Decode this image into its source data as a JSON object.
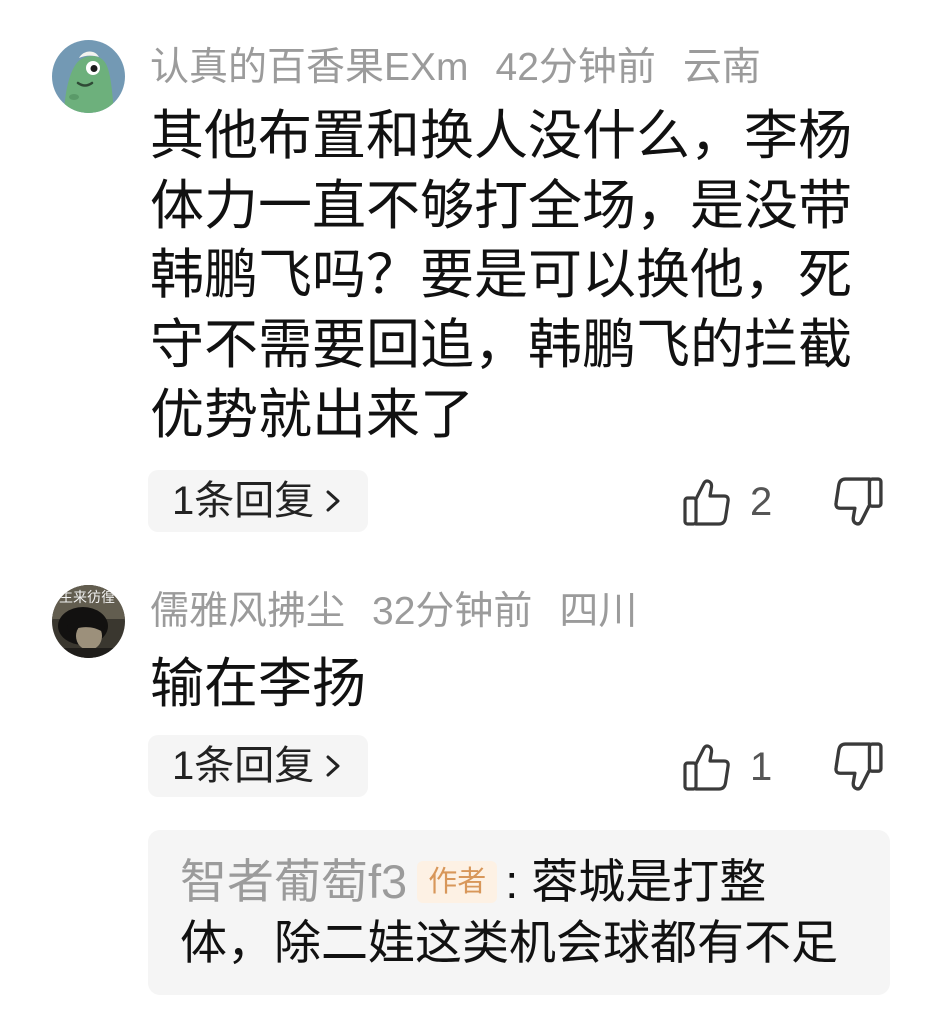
{
  "colors": {
    "text_primary": "#111111",
    "text_secondary": "#9b9b9b",
    "button_background": "#f5f5f5",
    "icon_stroke": "#3a3a3a",
    "author_badge_text": "#d8975a",
    "author_badge_background": "#fdf1e4"
  },
  "icons": {
    "like": "thumbs-up-icon",
    "dislike": "thumbs-down-icon",
    "reply_chevron": "chevron-right-icon"
  },
  "comments": [
    {
      "avatar_icon": "green-dinosaur-avatar",
      "username": "认真的百香果EXm",
      "time": "42分钟前",
      "location": "云南",
      "content_lines": [
        "其他布置和换人没什么，李杨",
        "体力一直不够打全场，是没带",
        "韩鹏飞吗？要是可以换他，死",
        "守不需要回追，韩鹏飞的拦截",
        "优势就出来了"
      ],
      "reply_button_label": "1条回复",
      "like_count": "2"
    },
    {
      "avatar_icon": "photo-avatar",
      "avatar_text": "生来彷徨",
      "username": "儒雅风拂尘",
      "time": "32分钟前",
      "location": "四川",
      "content_lines": [
        "输在李扬"
      ],
      "reply_button_label": "1条回复",
      "like_count": "1",
      "reply_preview": {
        "author": "智者葡萄f3",
        "author_badge": "作者",
        "separator": ":",
        "text_lines": [
          "蓉城是打整",
          "体，除二娃这类机会球都有不足"
        ]
      }
    }
  ]
}
